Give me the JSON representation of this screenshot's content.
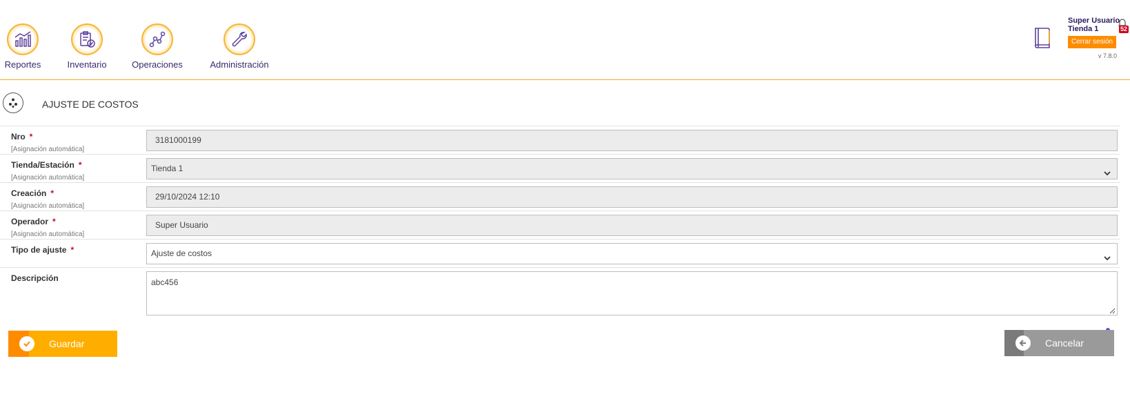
{
  "nav": {
    "items": [
      {
        "label": "Reportes",
        "icon": "chart-bars-icon"
      },
      {
        "label": "Inventario",
        "icon": "clipboard-check-icon"
      },
      {
        "label": "Operaciones",
        "icon": "route-icon"
      },
      {
        "label": "Administración",
        "icon": "wrench-icon"
      }
    ]
  },
  "user": {
    "name": "Super Usuario",
    "store": "Tienda 1",
    "notifications": "52",
    "logout_label": "Cerrar sesión",
    "version": "v 7.8.0"
  },
  "page": {
    "title": "AJUSTE DE COSTOS"
  },
  "form": {
    "auto_hint": "[Asignación automática]",
    "required_mark": "*",
    "fields": [
      {
        "label": "Nro",
        "value": "3181000199"
      },
      {
        "label": "Tienda/Estación",
        "value": "Tienda 1"
      },
      {
        "label": "Creación",
        "value": "29/10/2024 12:10"
      },
      {
        "label": "Operador",
        "value": "Super Usuario"
      },
      {
        "label": "Tipo de ajuste",
        "value": "Ajuste de costos"
      },
      {
        "label": "Descripción",
        "value": "abc456"
      }
    ]
  },
  "actions": {
    "save_label": "Guardar",
    "cancel_label": "Cancelar"
  },
  "colors": {
    "accent": "#ff8c00",
    "brand_text": "#3a2a6d",
    "required": "#d0021b"
  }
}
